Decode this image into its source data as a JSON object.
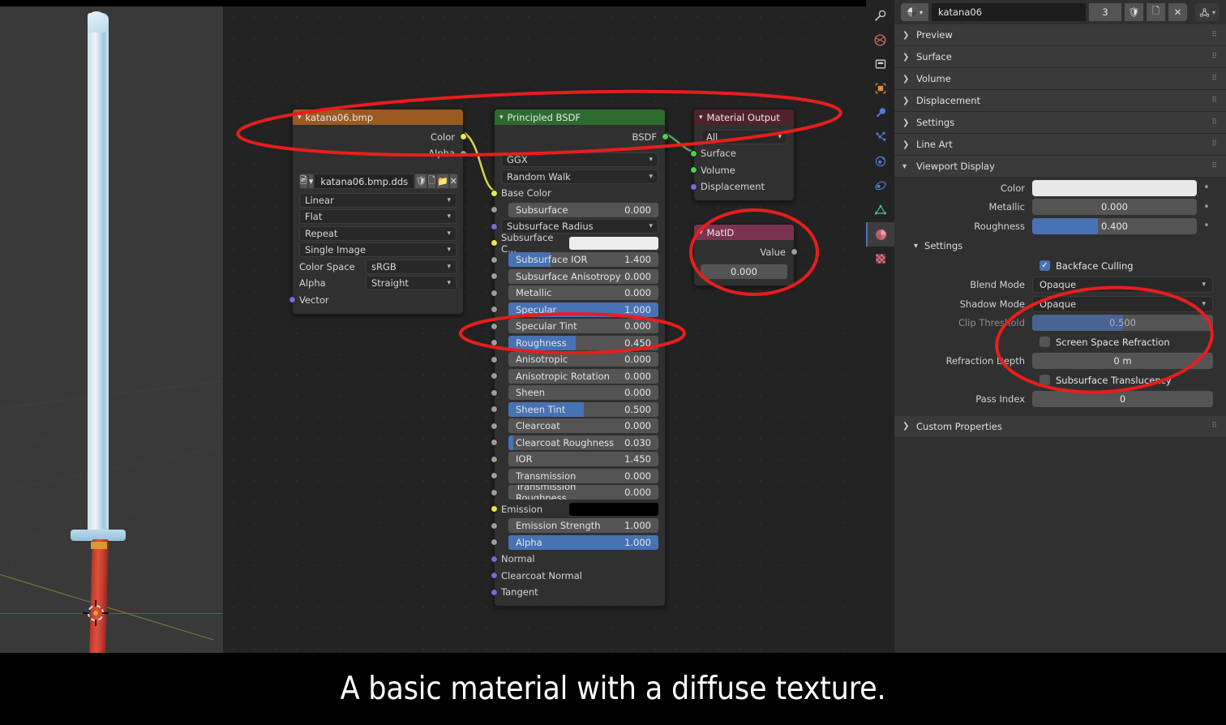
{
  "caption": "A basic material with a diffuse texture.",
  "viewport": {
    "name": "3d-viewport",
    "object": "katana sword model"
  },
  "node_editor": {
    "nodes": [
      {
        "id": "image-texture",
        "title": "katana06.bmp",
        "header_color": "#9a5a22",
        "outputs": [
          {
            "label": "Color",
            "socket": "yellow"
          },
          {
            "label": "Alpha",
            "socket": "grey"
          }
        ],
        "image_name": "katana06.bmp.dds",
        "dropdowns": [
          "Linear",
          "Flat",
          "Repeat",
          "Single Image"
        ],
        "props": [
          {
            "label": "Color Space",
            "value": "sRGB"
          },
          {
            "label": "Alpha",
            "value": "Straight"
          }
        ],
        "inputs": [
          {
            "label": "Vector",
            "socket": "purple"
          }
        ]
      },
      {
        "id": "principled-bsdf",
        "title": "Principled BSDF",
        "header_color": "#2e6b2e",
        "outputs": [
          {
            "label": "BSDF",
            "socket": "green"
          }
        ],
        "dropdowns": [
          "GGX",
          "Random Walk"
        ],
        "sockets": [
          {
            "label": "Base Color",
            "type": "color-label",
            "socket": "yellow"
          },
          {
            "label": "Subsurface",
            "type": "value",
            "value": "0.000",
            "fill": 0,
            "socket": "grey",
            "indent": true
          },
          {
            "label": "Subsurface Radius",
            "type": "dropdown",
            "value": "",
            "socket": "purple"
          },
          {
            "label": "Subsurface C...",
            "type": "swatch",
            "color": "#ededed",
            "socket": "yellow"
          },
          {
            "label": "Subsurface IOR",
            "type": "value",
            "value": "1.400",
            "fill": 28,
            "socket": "grey",
            "indent": true
          },
          {
            "label": "Subsurface Anisotropy",
            "type": "value",
            "value": "0.000",
            "fill": 0,
            "socket": "grey",
            "indent": true
          },
          {
            "label": "Metallic",
            "type": "value",
            "value": "0.000",
            "fill": 0,
            "socket": "grey",
            "indent": true
          },
          {
            "label": "Specular",
            "type": "value",
            "value": "1.000",
            "fill": 100,
            "socket": "grey",
            "indent": true
          },
          {
            "label": "Specular Tint",
            "type": "value",
            "value": "0.000",
            "fill": 0,
            "socket": "grey",
            "indent": true
          },
          {
            "label": "Roughness",
            "type": "value",
            "value": "0.450",
            "fill": 45,
            "socket": "grey",
            "indent": true
          },
          {
            "label": "Anisotropic",
            "type": "value",
            "value": "0.000",
            "fill": 0,
            "socket": "grey",
            "indent": true
          },
          {
            "label": "Anisotropic Rotation",
            "type": "value",
            "value": "0.000",
            "fill": 0,
            "socket": "grey",
            "indent": true
          },
          {
            "label": "Sheen",
            "type": "value",
            "value": "0.000",
            "fill": 0,
            "socket": "grey",
            "indent": true
          },
          {
            "label": "Sheen Tint",
            "type": "value",
            "value": "0.500",
            "fill": 50,
            "socket": "grey",
            "indent": true
          },
          {
            "label": "Clearcoat",
            "type": "value",
            "value": "0.000",
            "fill": 0,
            "socket": "grey",
            "indent": true
          },
          {
            "label": "Clearcoat Roughness",
            "type": "value",
            "value": "0.030",
            "fill": 3,
            "socket": "grey",
            "indent": true
          },
          {
            "label": "IOR",
            "type": "value",
            "value": "1.450",
            "fill": 0,
            "socket": "grey",
            "indent": true
          },
          {
            "label": "Transmission",
            "type": "value",
            "value": "0.000",
            "fill": 0,
            "socket": "grey",
            "indent": true
          },
          {
            "label": "Transmission Roughness",
            "type": "value",
            "value": "0.000",
            "fill": 0,
            "socket": "grey",
            "indent": true
          },
          {
            "label": "Emission",
            "type": "swatch",
            "color": "#000000",
            "socket": "yellow"
          },
          {
            "label": "Emission Strength",
            "type": "value",
            "value": "1.000",
            "fill": 0,
            "socket": "grey",
            "indent": true
          },
          {
            "label": "Alpha",
            "type": "value",
            "value": "1.000",
            "fill": 100,
            "socket": "grey",
            "indent": true
          },
          {
            "label": "Normal",
            "type": "plain",
            "socket": "purple"
          },
          {
            "label": "Clearcoat Normal",
            "type": "plain",
            "socket": "purple"
          },
          {
            "label": "Tangent",
            "type": "plain",
            "socket": "purple"
          }
        ]
      },
      {
        "id": "material-output",
        "title": "Material Output",
        "header_color": "#51222e",
        "outputs": [],
        "target": "All",
        "inputs": [
          {
            "label": "Surface",
            "socket": "green"
          },
          {
            "label": "Volume",
            "socket": "green"
          },
          {
            "label": "Displacement",
            "socket": "purple"
          }
        ]
      },
      {
        "id": "matid",
        "title": "MatID",
        "header_color": "#7c3350",
        "outputs": [
          {
            "label": "Value",
            "socket": "grey"
          }
        ],
        "value": "0.000"
      }
    ]
  },
  "properties": {
    "tabs": [
      {
        "name": "tool-tab",
        "icon": "tool-icon"
      },
      {
        "name": "render-tab",
        "icon": "render-camera-icon"
      },
      {
        "name": "output-tab",
        "icon": "printer-icon"
      },
      {
        "name": "object-tab",
        "icon": "object-square-icon"
      },
      {
        "name": "modifier-tab",
        "icon": "wrench-icon"
      },
      {
        "name": "particles-tab",
        "icon": "particles-icon"
      },
      {
        "name": "physics-tab",
        "icon": "physics-orbit-icon"
      },
      {
        "name": "constraints-tab",
        "icon": "constraints-icon"
      },
      {
        "name": "data-tab",
        "icon": "mesh-data-triangle-icon"
      },
      {
        "name": "material-tab",
        "icon": "material-sphere-icon",
        "selected": true
      },
      {
        "name": "texture-tab",
        "icon": "checker-texture-icon"
      }
    ],
    "header": {
      "material_name": "katana06",
      "users_count": "3",
      "buttons": [
        "shield-fake-user",
        "new-material-copy",
        "unlink-material"
      ],
      "filter_icon": "mesh-filter-icon"
    },
    "panels": [
      {
        "label": "Preview",
        "open": false
      },
      {
        "label": "Surface",
        "open": false
      },
      {
        "label": "Volume",
        "open": false
      },
      {
        "label": "Displacement",
        "open": false
      },
      {
        "label": "Settings",
        "open": false
      },
      {
        "label": "Line Art",
        "open": false
      },
      {
        "label": "Viewport Display",
        "open": true
      },
      {
        "label": "Custom Properties",
        "open": false
      }
    ],
    "viewport_display": {
      "rows": [
        {
          "label": "Color",
          "type": "color",
          "value": "#e8e8e8"
        },
        {
          "label": "Metallic",
          "type": "slider",
          "value": "0.000",
          "fill": 0
        },
        {
          "label": "Roughness",
          "type": "slider",
          "value": "0.400",
          "fill": 40
        }
      ],
      "settings_label": "Settings",
      "settings": {
        "backface_culling": {
          "label": "Backface Culling",
          "checked": true
        },
        "blend_mode": {
          "label": "Blend Mode",
          "value": "Opaque"
        },
        "shadow_mode": {
          "label": "Shadow Mode",
          "value": "Opaque"
        },
        "clip_threshold": {
          "label": "Clip Threshold",
          "value": "0.500",
          "fill": 50,
          "disabled": true
        },
        "screen_space_refraction": {
          "label": "Screen Space Refraction",
          "checked": false
        },
        "refraction_depth": {
          "label": "Refraction Depth",
          "value": "0 m"
        },
        "subsurface_translucency": {
          "label": "Subsurface Translucency",
          "checked": false
        },
        "pass_index": {
          "label": "Pass Index",
          "value": "0"
        }
      }
    }
  },
  "annotations": {
    "color": "#e81d1d",
    "ellipses": [
      {
        "name": "nodes-overview-highlight"
      },
      {
        "name": "matid-node-highlight"
      },
      {
        "name": "roughness-row-highlight"
      },
      {
        "name": "settings-block-highlight"
      }
    ]
  }
}
